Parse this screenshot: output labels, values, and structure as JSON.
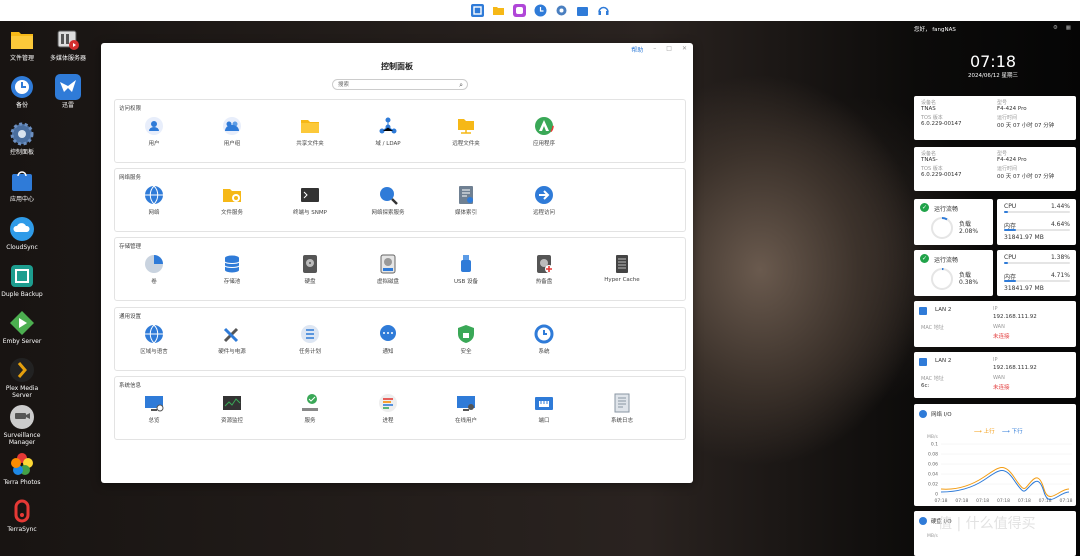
{
  "desktop_icons": [
    {
      "label": "文件管理",
      "icon": "folder-icon"
    },
    {
      "label": "多媒体服务器",
      "icon": "media-server-icon"
    },
    {
      "label": "备份",
      "icon": "backup-icon"
    },
    {
      "label": "迅雷",
      "icon": "thunder-icon"
    },
    {
      "label": "控制面板",
      "icon": "gear-icon"
    },
    {
      "label": "应用中心",
      "icon": "app-center-icon"
    },
    {
      "label": "CloudSync",
      "icon": "cloud-icon"
    },
    {
      "label": "Duple Backup",
      "icon": "duple-backup-icon"
    },
    {
      "label": "Emby Server",
      "icon": "emby-icon"
    },
    {
      "label": "Plex Media Server",
      "icon": "plex-icon"
    },
    {
      "label": "Surveillance Manager",
      "icon": "camera-icon"
    },
    {
      "label": "Terra Photos",
      "icon": "photos-icon"
    },
    {
      "label": "TerraSync",
      "icon": "terrasync-icon"
    }
  ],
  "window": {
    "title": "控制面板",
    "help": "帮助",
    "search_placeholder": "搜索",
    "sections": [
      {
        "title": "访问权限",
        "items": [
          "用户",
          "用户组",
          "共享文件夹",
          "域 / LDAP",
          "远程文件夹",
          "应用程序"
        ]
      },
      {
        "title": "网络服务",
        "items": [
          "网络",
          "文件服务",
          "终端与 SNMP",
          "网络探索服务",
          "媒体索引",
          "远程访问"
        ]
      },
      {
        "title": "存储管理",
        "items": [
          "卷",
          "存储池",
          "硬盘",
          "虚拟磁盘",
          "USB 设备",
          "热备盘",
          "Hyper Cache"
        ]
      },
      {
        "title": "通用设置",
        "items": [
          "区域与语言",
          "硬件与电源",
          "任务计划",
          "通知",
          "安全",
          "系统"
        ]
      },
      {
        "title": "系统信息",
        "items": [
          "总览",
          "资源监控",
          "服务",
          "进程",
          "在线用户",
          "端口",
          "系统日志"
        ]
      }
    ]
  },
  "panel": {
    "greeting": "您好，  fangNAS",
    "time": "07:18",
    "date": "2024/06/12 星期三",
    "devices": [
      {
        "name_label": "设备名",
        "name": "TNAS",
        "model_label": "型号",
        "model": "F4-424 Pro",
        "tos_label": "TOS 版本",
        "tos": "6.0.229-00147",
        "uptime_label": "运行时间",
        "uptime": "00 天 07 小时 07 分钟"
      },
      {
        "name_label": "设备名",
        "name": "TNAS-",
        "model_label": "型号",
        "model": "F4-424 Pro",
        "tos_label": "TOS 版本",
        "tos": "6.0.229-00147",
        "uptime_label": "运行时间",
        "uptime": "00 天 07 小时 07 分钟"
      }
    ],
    "status": [
      {
        "title": "运行流畅",
        "load_label": "负载",
        "load": "2.08%",
        "cpu_label": "CPU",
        "cpu": "1.44%",
        "cpu_frac": 0.0144,
        "mem_label": "内存",
        "mem": "4.64%",
        "mem_frac": 0.0464,
        "mem_total": "31841.97 MB"
      },
      {
        "title": "运行流畅",
        "load_label": "负载",
        "load": "0.38%",
        "cpu_label": "CPU",
        "cpu": "1.38%",
        "cpu_frac": 0.0138,
        "mem_label": "内存",
        "mem": "4.71%",
        "mem_frac": 0.0471,
        "mem_total": "31841.97 MB"
      }
    ],
    "lans": [
      {
        "name": "LAN 2",
        "ip_label": "IP",
        "ip": "192.168.111.92",
        "mac_label": "MAC 地址",
        "mac": "",
        "wan_label": "WAN",
        "wan": "未连接"
      },
      {
        "name": "LAN 2",
        "ip_label": "IP",
        "ip": "192.168.111.92",
        "mac_label": "MAC 地址",
        "mac": "6c:",
        "wan_label": "WAN",
        "wan": "未连接"
      }
    ],
    "netio": {
      "title": "网络 I/O",
      "unit": "MB/s",
      "up": "上行",
      "down": "下行",
      "yticks": [
        "0.1",
        "0.08",
        "0.06",
        "0.04",
        "0.02",
        "0"
      ],
      "xticks": [
        "07:18",
        "07:18",
        "07:18",
        "07:18",
        "07:18",
        "07:18",
        "07:18"
      ]
    },
    "diskio": {
      "title": "硬盘 I/O",
      "unit": "MB/s"
    }
  },
  "watermark": "值 | 什么值得买"
}
